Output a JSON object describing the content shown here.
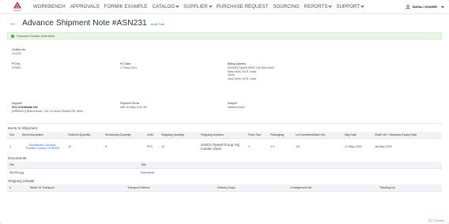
{
  "nav": {
    "logo_text": "Gnexus",
    "items": [
      {
        "label": "WORKBENCH",
        "dropdown": false
      },
      {
        "label": "APPROVALS",
        "dropdown": false
      },
      {
        "label": "FORMIK EXAMPLE",
        "dropdown": false
      },
      {
        "label": "CATALOG",
        "dropdown": true
      },
      {
        "label": "SUPPLIER",
        "dropdown": true
      },
      {
        "label": "PURCHASE REQUEST",
        "dropdown": false
      },
      {
        "label": "SOURCING",
        "dropdown": false
      },
      {
        "label": "REPORTS",
        "dropdown": true
      },
      {
        "label": "SUPPORT",
        "dropdown": true
      }
    ],
    "user": "BURALI VIGANRE"
  },
  "page": {
    "title": "Advance Shipment Note #ASN231",
    "audit_link": "Audit Trail",
    "status": "Shipment Details Submitted"
  },
  "details": {
    "challan_label": "Challan No",
    "challan_value": "121222",
    "po_no_label": "PO No",
    "po_no_value": "PO503",
    "po_date_label": "PO Date",
    "po_date_value": "17-May-2023",
    "billing_label": "Billing Address",
    "billing_line1": "[SA005] Flywell APAC HQ New Delhi",
    "billing_line2": "New Delhi, NCR, India",
    "billing_line3": "None",
    "billing_line4": "New Delhi, NCR, India",
    "supplier_label": "Supplier",
    "supplier_name": "ZCL Chemicals Ltd",
    "supplier_address": "[09850001] Brita Aurora, 12A, Dr Annie Besant Rd, Worli",
    "payment_label": "Payment Terms",
    "payment_value": "with 30 days Due net",
    "subject_label": "Subject",
    "subject_value": "Added phone"
  },
  "items_section": {
    "title": "Items In Shipment",
    "headers": [
      "Sr#",
      "Item/Description",
      "Ordered Quantity",
      "Remaining Quantity",
      "UoM",
      "Shipping Quantity",
      "Shipping Address",
      "Pack Size",
      "Packaging",
      "Lot Numbers/Batch No",
      "Mfg Date",
      "Shelf Life / Warranty Expiry Date"
    ],
    "rows": [
      {
        "sr": "1",
        "item_line1": "Alumitecsin Osclioza,",
        "item_line2": "Powder Custom Of 90000",
        "ordered": "12",
        "remaining": "0",
        "uom": "PTC",
        "shipping_qty": "12",
        "address_line1": "SA001 Flywell Group HQ",
        "address_line2": "London Store",
        "pack_size": "1",
        "packaging": "1:1",
        "lot": "111",
        "mfg": "17-May-2023",
        "shelf": "18-May-2023"
      }
    ]
  },
  "documents": {
    "title": "Documents",
    "headers": [
      "File",
      "Title"
    ],
    "rows": [
      {
        "file": "981293.jpg",
        "title": "Document"
      }
    ]
  },
  "shipping": {
    "title": "Shipping Details",
    "headers": [
      "#",
      "Mode Of Transport",
      "Transport Partner",
      "Delivery Days",
      "Consignment No",
      "Tracking No"
    ]
  },
  "watermark": "Chatbot"
}
